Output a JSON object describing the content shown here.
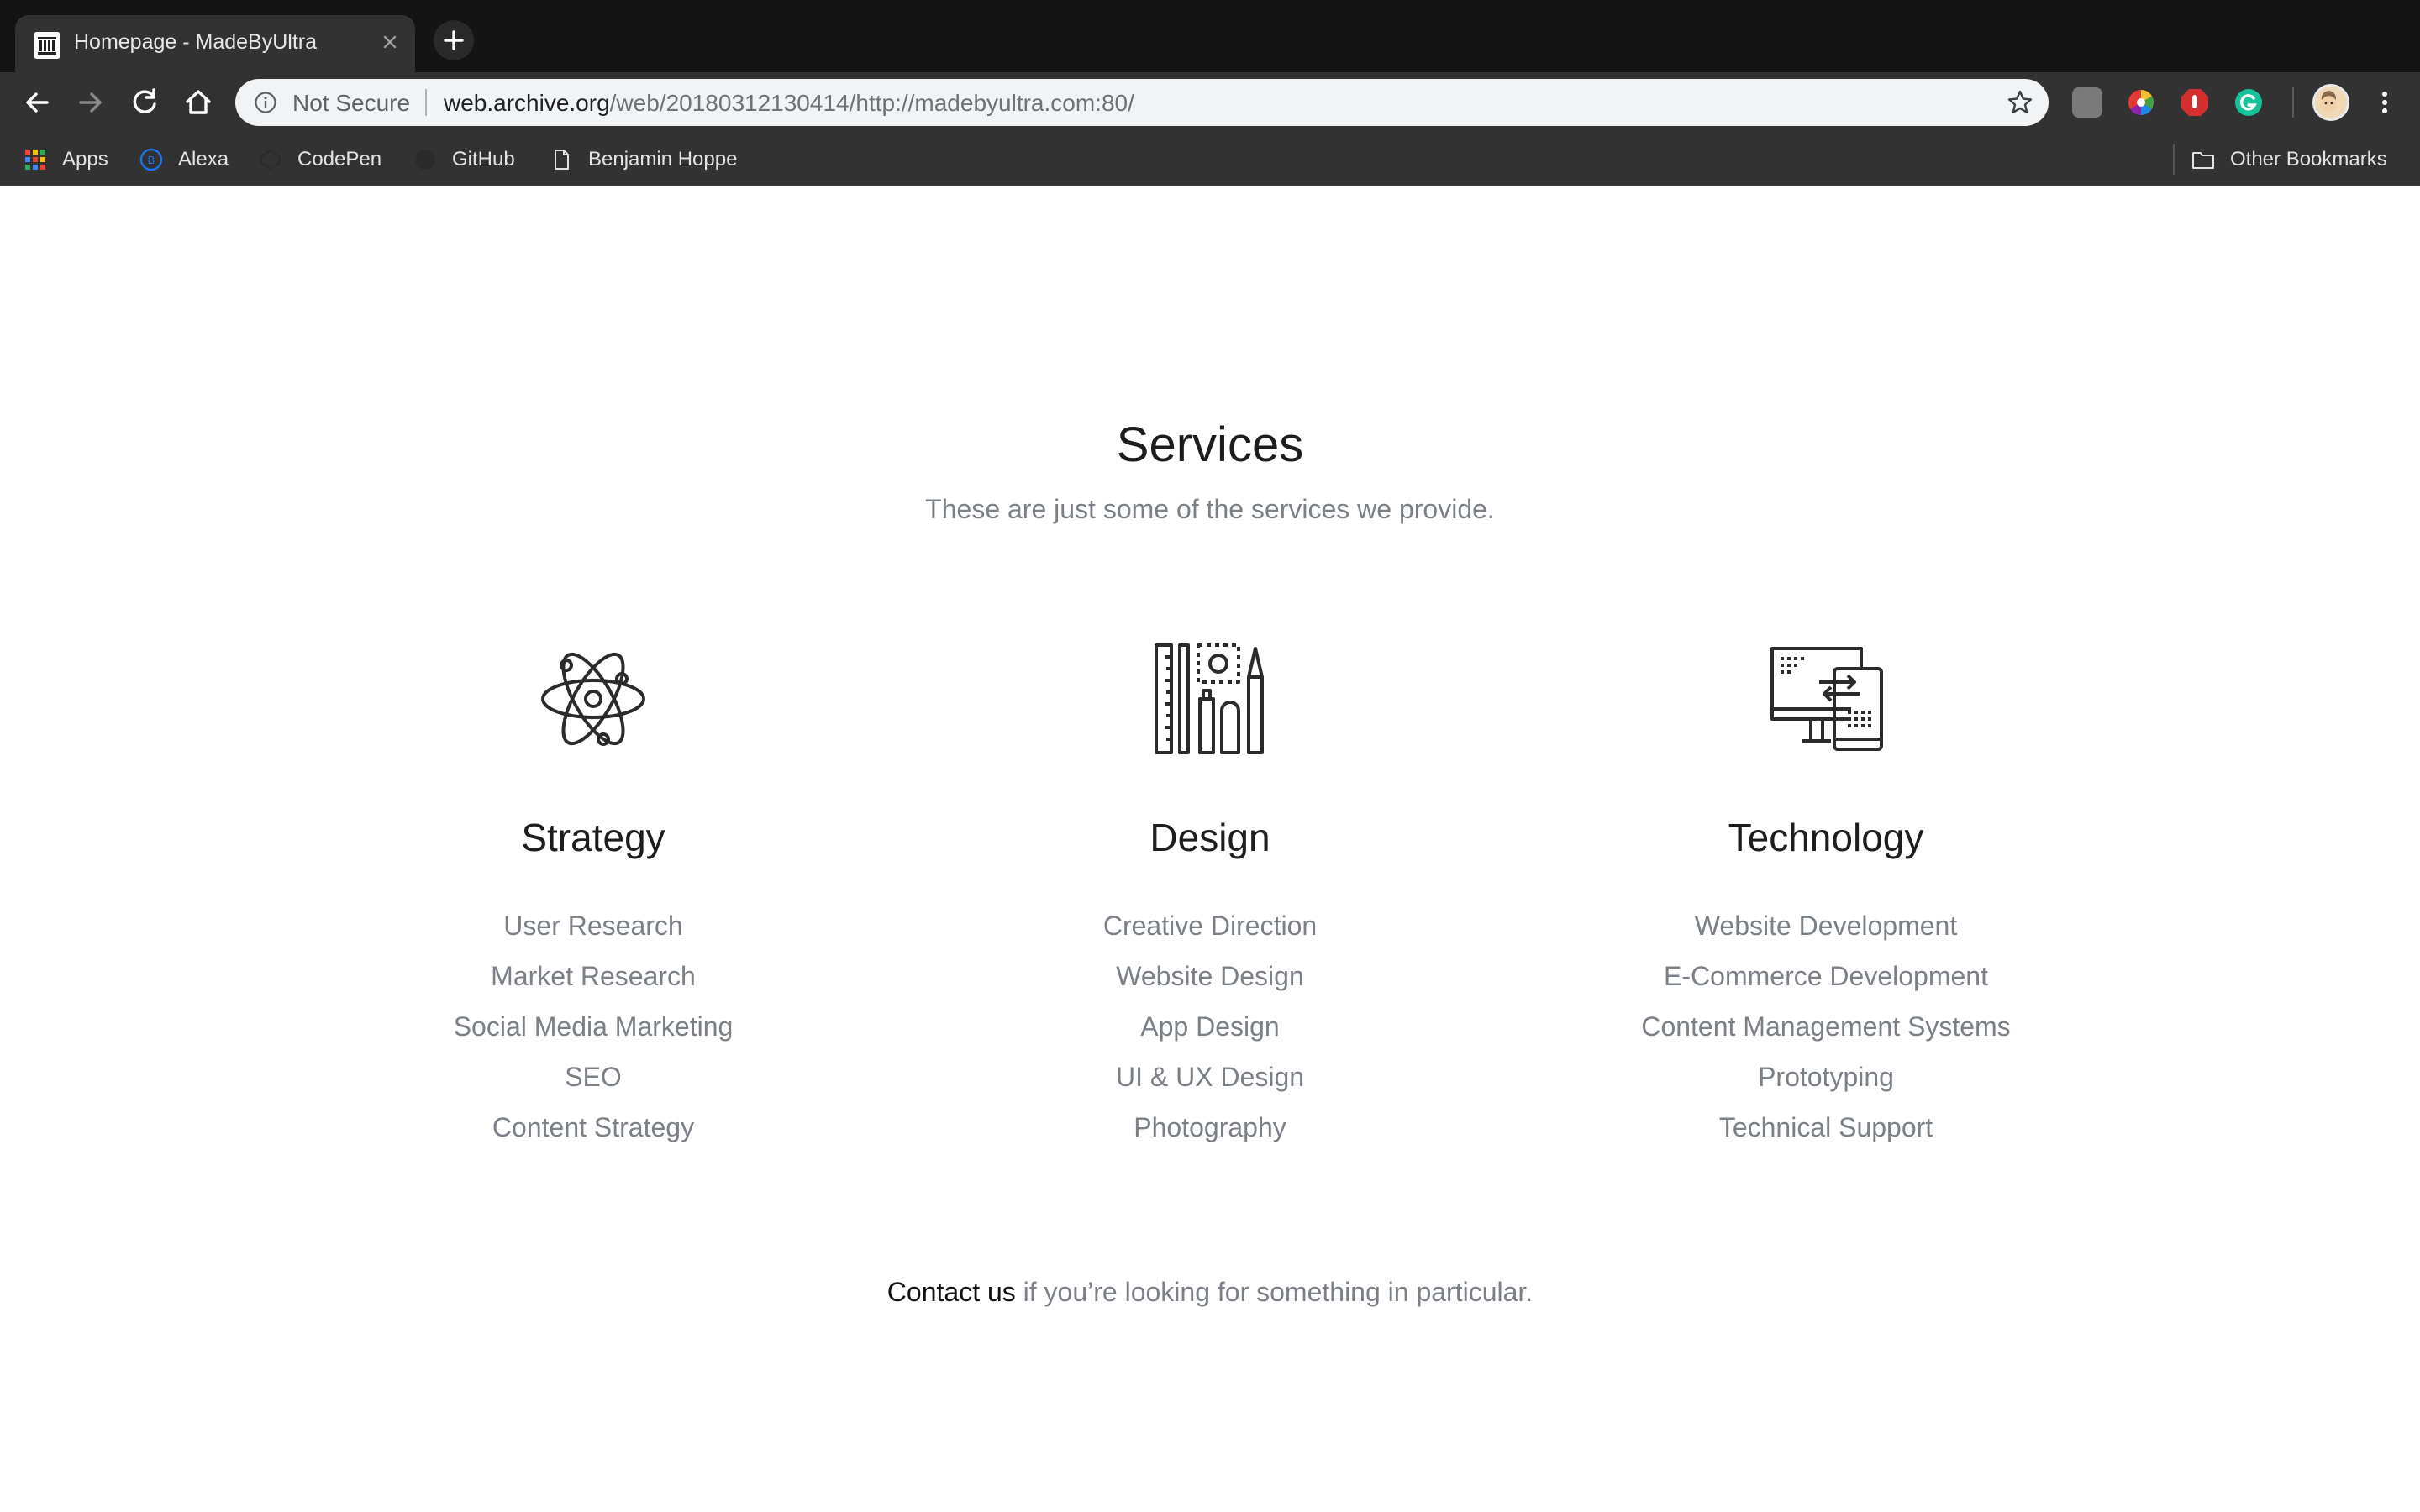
{
  "browser": {
    "tab_title": "Homepage - MadeByUltra",
    "security_label": "Not Secure",
    "url_host": "web.archive.org",
    "url_path": "/web/20180312130414/http://madebyultra.com:80/",
    "bookmarks": [
      {
        "label": "Apps",
        "icon": "apps-grid-icon"
      },
      {
        "label": "Alexa",
        "icon": "alexa-icon"
      },
      {
        "label": "CodePen",
        "icon": "codepen-icon"
      },
      {
        "label": "GitHub",
        "icon": "github-icon"
      },
      {
        "label": "Benjamin Hoppe",
        "icon": "page-icon"
      }
    ],
    "other_bookmarks": "Other Bookmarks"
  },
  "services": {
    "title": "Services",
    "subtitle": "These are just some of the services we provide.",
    "columns": [
      {
        "title": "Strategy",
        "icon": "atom-icon",
        "items": [
          "User Research",
          "Market Research",
          "Social Media Marketing",
          "SEO",
          "Content Strategy"
        ]
      },
      {
        "title": "Design",
        "icon": "design-tools-icon",
        "items": [
          "Creative Direction",
          "Website Design",
          "App Design",
          "UI & UX Design",
          "Photography"
        ]
      },
      {
        "title": "Technology",
        "icon": "devices-icon",
        "items": [
          "Website Development",
          "E-Commerce Development",
          "Content Management Systems",
          "Prototyping",
          "Technical Support"
        ]
      }
    ],
    "contact_link": "Contact us",
    "contact_text": " if you’re looking for something in particular."
  }
}
